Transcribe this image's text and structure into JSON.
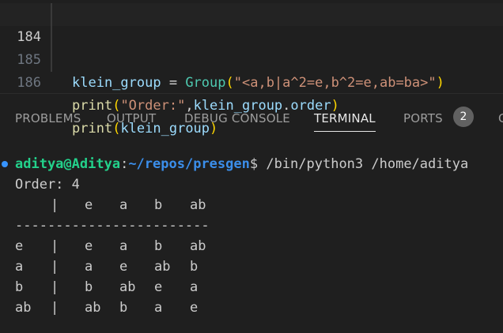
{
  "editor": {
    "lines": [
      {
        "number": "184",
        "tokens": [
          {
            "text": "klein_group",
            "kind": "var"
          },
          {
            "text": " = ",
            "kind": "op"
          },
          {
            "text": "Group",
            "kind": "class"
          },
          {
            "text": "(",
            "kind": "punc"
          },
          {
            "text": "\"<a,b|a^2=e,b^2=e,ab=ba>\"",
            "kind": "str"
          },
          {
            "text": ")",
            "kind": "punc"
          }
        ]
      },
      {
        "number": "185",
        "tokens": [
          {
            "text": "print",
            "kind": "fn"
          },
          {
            "text": "(",
            "kind": "punc"
          },
          {
            "text": "\"Order:\"",
            "kind": "str"
          },
          {
            "text": ",",
            "kind": "plain"
          },
          {
            "text": "klein_group",
            "kind": "var"
          },
          {
            "text": ".",
            "kind": "plain"
          },
          {
            "text": "order",
            "kind": "var"
          },
          {
            "text": ")",
            "kind": "punc"
          }
        ]
      },
      {
        "number": "186",
        "tokens": [
          {
            "text": "print",
            "kind": "fn"
          },
          {
            "text": "(",
            "kind": "punc"
          },
          {
            "text": "klein_group",
            "kind": "var"
          },
          {
            "text": ")",
            "kind": "punc"
          }
        ]
      }
    ]
  },
  "panel": {
    "tabs": [
      {
        "label": "PROBLEMS"
      },
      {
        "label": "OUTPUT"
      },
      {
        "label": "DEBUG CONSOLE"
      },
      {
        "label": "TERMINAL"
      },
      {
        "label": "PORTS"
      }
    ],
    "active_tab": "TERMINAL",
    "ports_badge": "2",
    "overflow_glyph": "G"
  },
  "terminal": {
    "prompt": {
      "user_host": "aditya@Aditya",
      "separator": ":",
      "path": "~/repos/presgen",
      "dollar": "$",
      "command": " /bin/python3 /home/aditya"
    },
    "order_line": "Order: 4",
    "table": {
      "header": [
        "",
        "e",
        "a",
        "b",
        "ab"
      ],
      "divider": "------------------------",
      "rows": [
        [
          "e",
          "e",
          "a",
          "b",
          "ab"
        ],
        [
          "a",
          "a",
          "e",
          "ab",
          "b"
        ],
        [
          "b",
          "b",
          "ab",
          "e",
          "a"
        ],
        [
          "ab",
          "ab",
          "b",
          "a",
          "e"
        ]
      ],
      "bar": "|"
    }
  },
  "colors": {
    "background": "#1f1f1f",
    "accent_badge": "#616161",
    "prompt_dot": "#3794ff",
    "user_color": "#23d18b",
    "path_color": "#3b8eea"
  }
}
